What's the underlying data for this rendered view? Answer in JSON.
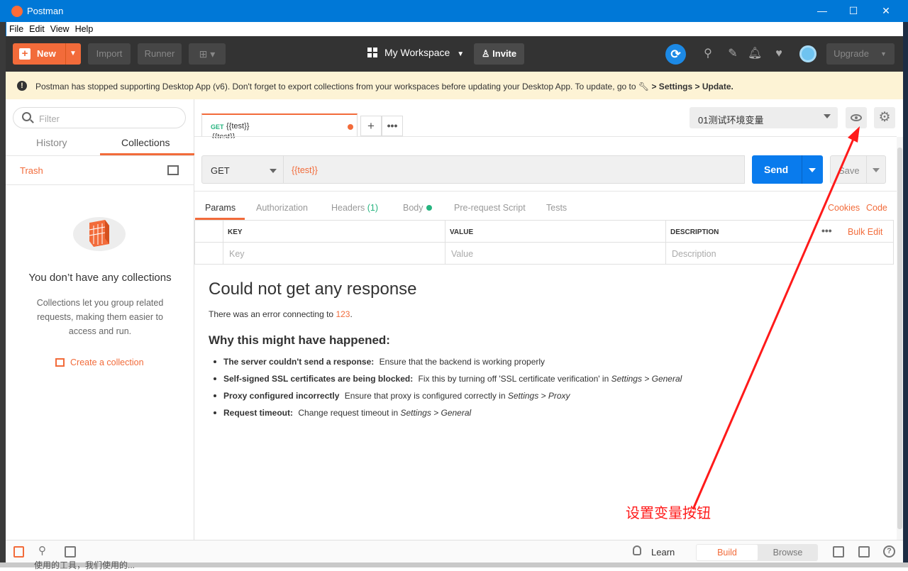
{
  "window": {
    "title": "Postman",
    "min_glyph": "—",
    "max_glyph": "☐",
    "close_glyph": "✕"
  },
  "menu": [
    "File",
    "Edit",
    "View",
    "Help"
  ],
  "header": {
    "new_label": "New",
    "import_label": "Import",
    "runner_label": "Runner",
    "workspace_label": "My Workspace",
    "invite_label": "Invite",
    "upgrade_label": "Upgrade"
  },
  "banner": {
    "text_before": "Postman has stopped supporting Desktop App (v6). Don't forget to export collections from your workspaces before updating your Desktop App. To update, go to ",
    "text_bold": "> Settings > Update."
  },
  "sidebar": {
    "filter_placeholder": "Filter",
    "tabs": [
      "History",
      "Collections"
    ],
    "active_tab": "Collections",
    "trash_label": "Trash",
    "empty_title": "You don’t have any collections",
    "empty_desc": "Collections let you group related requests, making them easier to access and run.",
    "create_label": "Create a collection"
  },
  "request_tab": {
    "method": "GET",
    "name": "{{test}}",
    "name_below": "{{test}}"
  },
  "environment": {
    "selected": "01测试环境变量"
  },
  "url_bar": {
    "method": "GET",
    "url": "{{test}}",
    "send_label": "Send",
    "save_label": "Save"
  },
  "param_tabs": {
    "params": "Params",
    "authorization": "Authorization",
    "headers": "Headers",
    "headers_count": "(1)",
    "body": "Body",
    "prerequest": "Pre-request Script",
    "tests": "Tests",
    "cookies": "Cookies",
    "code": "Code"
  },
  "params_table": {
    "headers": [
      "KEY",
      "VALUE",
      "DESCRIPTION"
    ],
    "bulk_edit": "Bulk Edit",
    "placeholders": [
      "Key",
      "Value",
      "Description"
    ]
  },
  "response": {
    "title": "Could not get any response",
    "sub_before": "There was an error connecting to ",
    "sub_link": "123",
    "sub_after": ".",
    "why": "Why this might have happened:",
    "items": [
      {
        "bold": "The server couldn't send a response:",
        "text": "Ensure that the backend is working properly",
        "ital": ""
      },
      {
        "bold": "Self-signed SSL certificates are being blocked:",
        "text": "Fix this by turning off 'SSL certificate verification' in ",
        "ital": "Settings > General"
      },
      {
        "bold": "Proxy configured incorrectly",
        "text": "Ensure that proxy is configured correctly in ",
        "ital": "Settings > Proxy"
      },
      {
        "bold": "Request timeout:",
        "text": "Change request timeout in ",
        "ital": "Settings > General"
      }
    ]
  },
  "statusbar": {
    "learn_label": "Learn",
    "build_label": "Build",
    "browse_label": "Browse"
  },
  "annotation": {
    "text": "设置变量按钮",
    "color": "#ff1a1a"
  },
  "background_text": "使用的工具，我们使用的...",
  "colors": {
    "accent": "#f26b3a",
    "send": "#097bed",
    "success": "#26b47f",
    "titlebar": "#0078d7"
  }
}
